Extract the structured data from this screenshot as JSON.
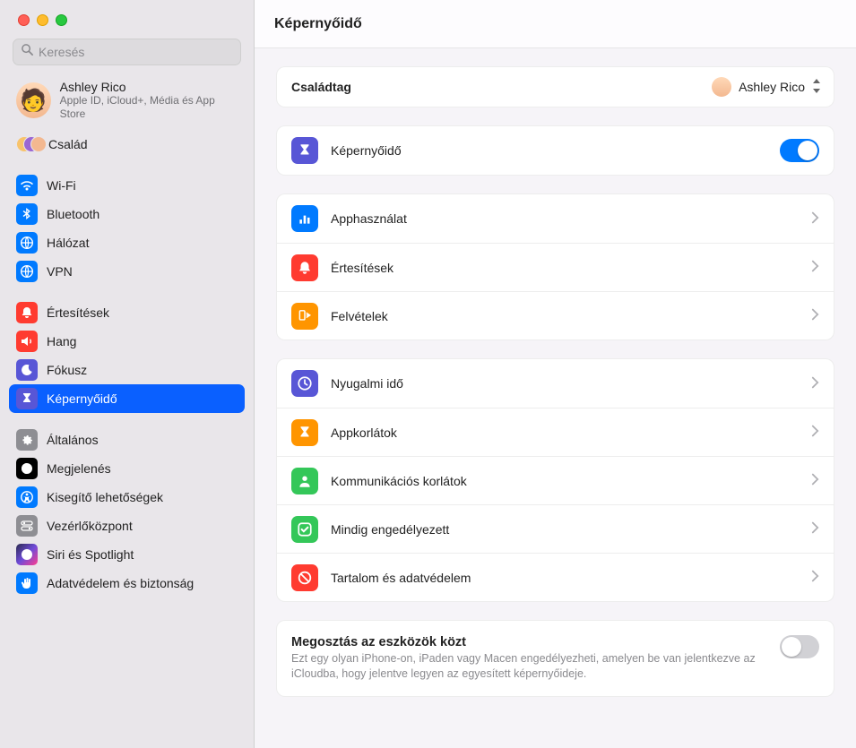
{
  "window": {
    "title": "Képernyőidő"
  },
  "search": {
    "placeholder": "Keresés"
  },
  "account": {
    "name": "Ashley Rico",
    "subtitle": "Apple ID, iCloud+, Média és App Store"
  },
  "sidebar": {
    "family_label": "Család",
    "items": [
      {
        "label": "Wi-Fi",
        "color": "#007aff",
        "icon": "wifi"
      },
      {
        "label": "Bluetooth",
        "color": "#007aff",
        "icon": "bluetooth"
      },
      {
        "label": "Hálózat",
        "color": "#007aff",
        "icon": "globe"
      },
      {
        "label": "VPN",
        "color": "#007aff",
        "icon": "globe"
      }
    ],
    "items2": [
      {
        "label": "Értesítések",
        "color": "#ff3b30",
        "icon": "bell"
      },
      {
        "label": "Hang",
        "color": "#ff3b30",
        "icon": "sound"
      },
      {
        "label": "Fókusz",
        "color": "#5856d6",
        "icon": "moon"
      },
      {
        "label": "Képernyőidő",
        "color": "#5856d6",
        "icon": "hourglass",
        "selected": true
      }
    ],
    "items3": [
      {
        "label": "Általános",
        "color": "#8e8e93",
        "icon": "gear"
      },
      {
        "label": "Megjelenés",
        "color": "#000000",
        "icon": "appearance"
      },
      {
        "label": "Kisegítő lehetőségek",
        "color": "#007aff",
        "icon": "accessibility"
      },
      {
        "label": "Vezérlőközpont",
        "color": "#8e8e93",
        "icon": "switches"
      },
      {
        "label": "Siri és Spotlight",
        "color": "#3a3a3c",
        "icon": "siri"
      },
      {
        "label": "Adatvédelem és biztonság",
        "color": "#007aff",
        "icon": "hand"
      }
    ]
  },
  "family_member": {
    "label": "Családtag",
    "selected": "Ashley Rico"
  },
  "screen_time_toggle": {
    "label": "Képernyőidő",
    "on": true,
    "icon_color": "#5856d6"
  },
  "usage_group": [
    {
      "label": "Apphasználat",
      "color": "#007aff",
      "icon": "barchart"
    },
    {
      "label": "Értesítések",
      "color": "#ff3b30",
      "icon": "bell"
    },
    {
      "label": "Felvételek",
      "color": "#ff9500",
      "icon": "pickup"
    }
  ],
  "limits_group": [
    {
      "label": "Nyugalmi idő",
      "color": "#5856d6",
      "icon": "clock"
    },
    {
      "label": "Appkorlátok",
      "color": "#ff9500",
      "icon": "hourglass"
    },
    {
      "label": "Kommunikációs korlátok",
      "color": "#34c759",
      "icon": "person"
    },
    {
      "label": "Mindig engedélyezett",
      "color": "#34c759",
      "icon": "check"
    },
    {
      "label": "Tartalom és adatvédelem",
      "color": "#ff3b30",
      "icon": "nosign"
    }
  ],
  "share": {
    "title": "Megosztás az eszközök közt",
    "subtitle": "Ezt egy olyan iPhone-on, iPaden vagy Macen engedélyezheti, amelyen be van jelentkezve az iCloudba, hogy jelentve legyen az egyesített képernyőideje.",
    "on": false
  }
}
